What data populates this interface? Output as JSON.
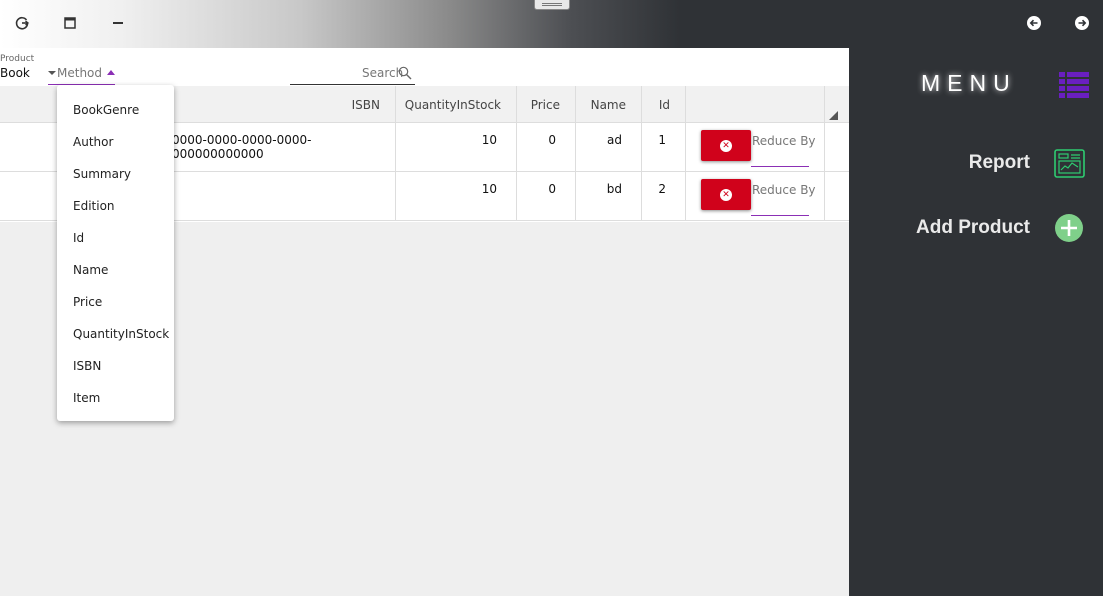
{
  "filter": {
    "product_label": "Product",
    "product_value": "Book",
    "method_placeholder": "Method",
    "search_placeholder": "Search"
  },
  "grid": {
    "columns": [
      "ISBN",
      "QuantityInStock",
      "Price",
      "Name",
      "Id"
    ],
    "rows": [
      {
        "isbn": "0000-0000-0000-0000-000000000000",
        "quantity": "10",
        "price": "0",
        "name": "ad",
        "id": "1",
        "reduce_placeholder": "Reduce By"
      },
      {
        "isbn": "",
        "quantity": "10",
        "price": "0",
        "name": "bd",
        "id": "2",
        "reduce_placeholder": "Reduce By"
      }
    ]
  },
  "dropdown": {
    "items": [
      "BookGenre",
      "Author",
      "Summary",
      "Edition",
      "Id",
      "Name",
      "Price",
      "QuantityInStock",
      "ISBN",
      "Item"
    ]
  },
  "sidebar": {
    "title": "MENU",
    "items": [
      {
        "label": "Report",
        "icon": "report-icon"
      },
      {
        "label": "Add Product",
        "icon": "add-circle-icon"
      }
    ]
  },
  "colors": {
    "accent": "#8b2fb5",
    "delete": "#d0021b",
    "sidebar_bg": "#2f3236",
    "report_icon": "#2ecc71",
    "add_icon": "#7fd08a"
  }
}
